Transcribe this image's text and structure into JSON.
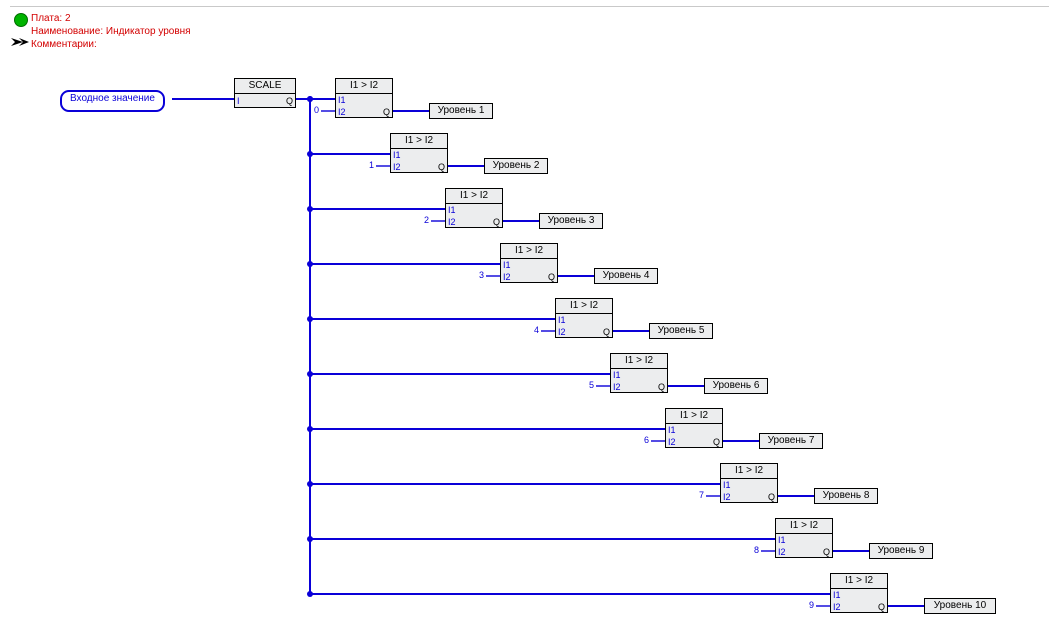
{
  "header": {
    "plate": "Плата: 2",
    "name_label": "Наименование: Индикатор уровня",
    "comments": "Комментарии:"
  },
  "input_block": {
    "label": "Входное значение"
  },
  "scale_block": {
    "title": "SCALE",
    "in_pin": "I",
    "out_pin": "Q"
  },
  "cmp_title": "I1 > I2",
  "cmp_pin_i1": "I1",
  "cmp_pin_i2": "I2",
  "cmp_pin_q": "Q",
  "chart_data": {
    "type": "table",
    "title": "Level indicator comparator ladder",
    "rows": [
      {
        "index": 0,
        "i2_value": 0,
        "output_label": "Уровень 1"
      },
      {
        "index": 1,
        "i2_value": 1,
        "output_label": "Уровень 2"
      },
      {
        "index": 2,
        "i2_value": 2,
        "output_label": "Уровень 3"
      },
      {
        "index": 3,
        "i2_value": 3,
        "output_label": "Уровень 4"
      },
      {
        "index": 4,
        "i2_value": 4,
        "output_label": "Уровень 5"
      },
      {
        "index": 5,
        "i2_value": 5,
        "output_label": "Уровень 6"
      },
      {
        "index": 6,
        "i2_value": 6,
        "output_label": "Уровень 7"
      },
      {
        "index": 7,
        "i2_value": 7,
        "output_label": "Уровень 8"
      },
      {
        "index": 8,
        "i2_value": 8,
        "output_label": "Уровень 9"
      },
      {
        "index": 9,
        "i2_value": 9,
        "output_label": "Уровень 10"
      }
    ]
  }
}
